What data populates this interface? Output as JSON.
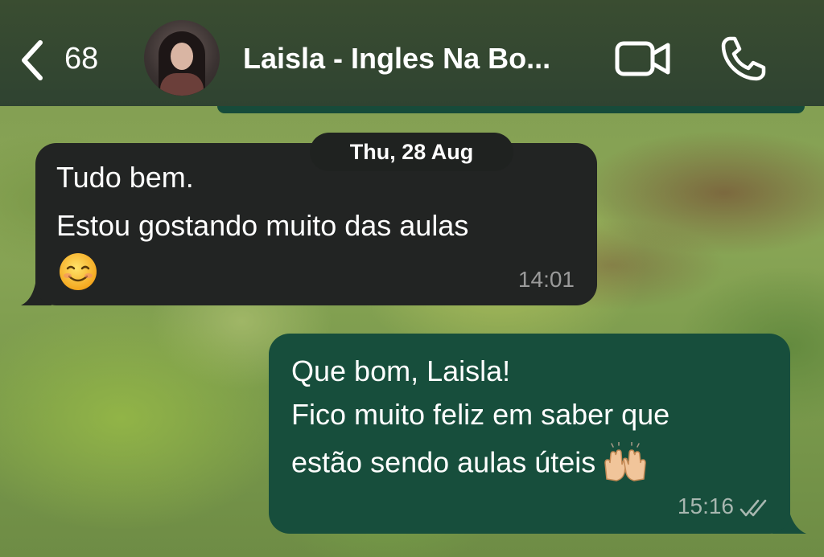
{
  "header": {
    "back_count": "68",
    "contact_name": "Laisla - Ingles Na Bo...",
    "back_icon": "chevron-left-icon",
    "video_icon": "video-camera-icon",
    "phone_icon": "phone-icon"
  },
  "date_separator": "Thu, 28 Aug",
  "messages": [
    {
      "direction": "incoming",
      "lines": [
        "Tudo bem.",
        "Estou gostando muito das aulas"
      ],
      "emoji": "smiling-face-icon",
      "time": "14:01"
    },
    {
      "direction": "outgoing",
      "lines": [
        "Que bom, Laisla!",
        "Fico muito feliz em saber que",
        "estão sendo aulas úteis"
      ],
      "emoji": "raising-hands-icon",
      "time": "15:16",
      "status": "read-double-tick-icon"
    }
  ],
  "colors": {
    "header_bg": "#2f4331",
    "incoming_bubble": "#222423",
    "outgoing_bubble": "#174e3c",
    "date_pill": "#1f2220"
  }
}
